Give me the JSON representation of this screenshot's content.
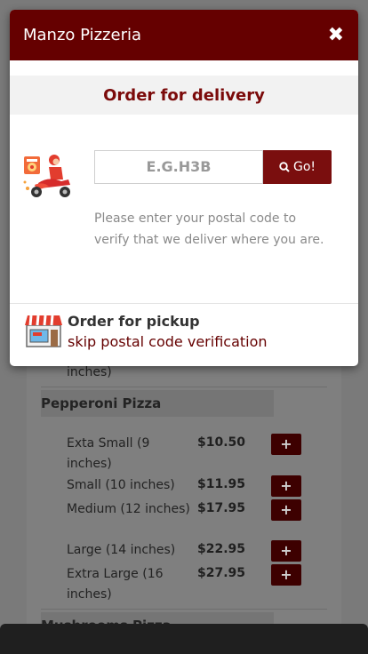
{
  "modal": {
    "title": "Manzo Pizzeria",
    "close_symbol": "✖",
    "subtitle": "Order for delivery",
    "postal_placeholder": "E.G.H3B",
    "go_label": "Go!",
    "help_text": "Please enter your postal code to verify that we deliver where you are.",
    "pickup_title": "Order for pickup",
    "pickup_link": "skip postal code verification",
    "icons": {
      "delivery": "scooter-delivery-icon",
      "pickup": "storefront-icon",
      "search": "search-icon",
      "close": "close-icon"
    }
  },
  "menu": {
    "partial_above": "inches)",
    "sections": [
      {
        "title": "Pepperoni Pizza",
        "items": [
          {
            "size": "Exta Small (9 inches)",
            "price": "$10.50"
          },
          {
            "size": "Small (10 inches)",
            "price": "$11.95"
          },
          {
            "size": "Medium (12 inches)",
            "price": "$17.95"
          },
          {
            "size": "Large (14 inches)",
            "price": "$22.95"
          },
          {
            "size": "Extra Large (16 inches)",
            "price": "$27.95"
          }
        ]
      },
      {
        "title": "Mushrooms Pizza",
        "items": []
      }
    ],
    "add_symbol": "+"
  },
  "colors": {
    "brand": "#650000",
    "accent": "#7a0e0e"
  }
}
